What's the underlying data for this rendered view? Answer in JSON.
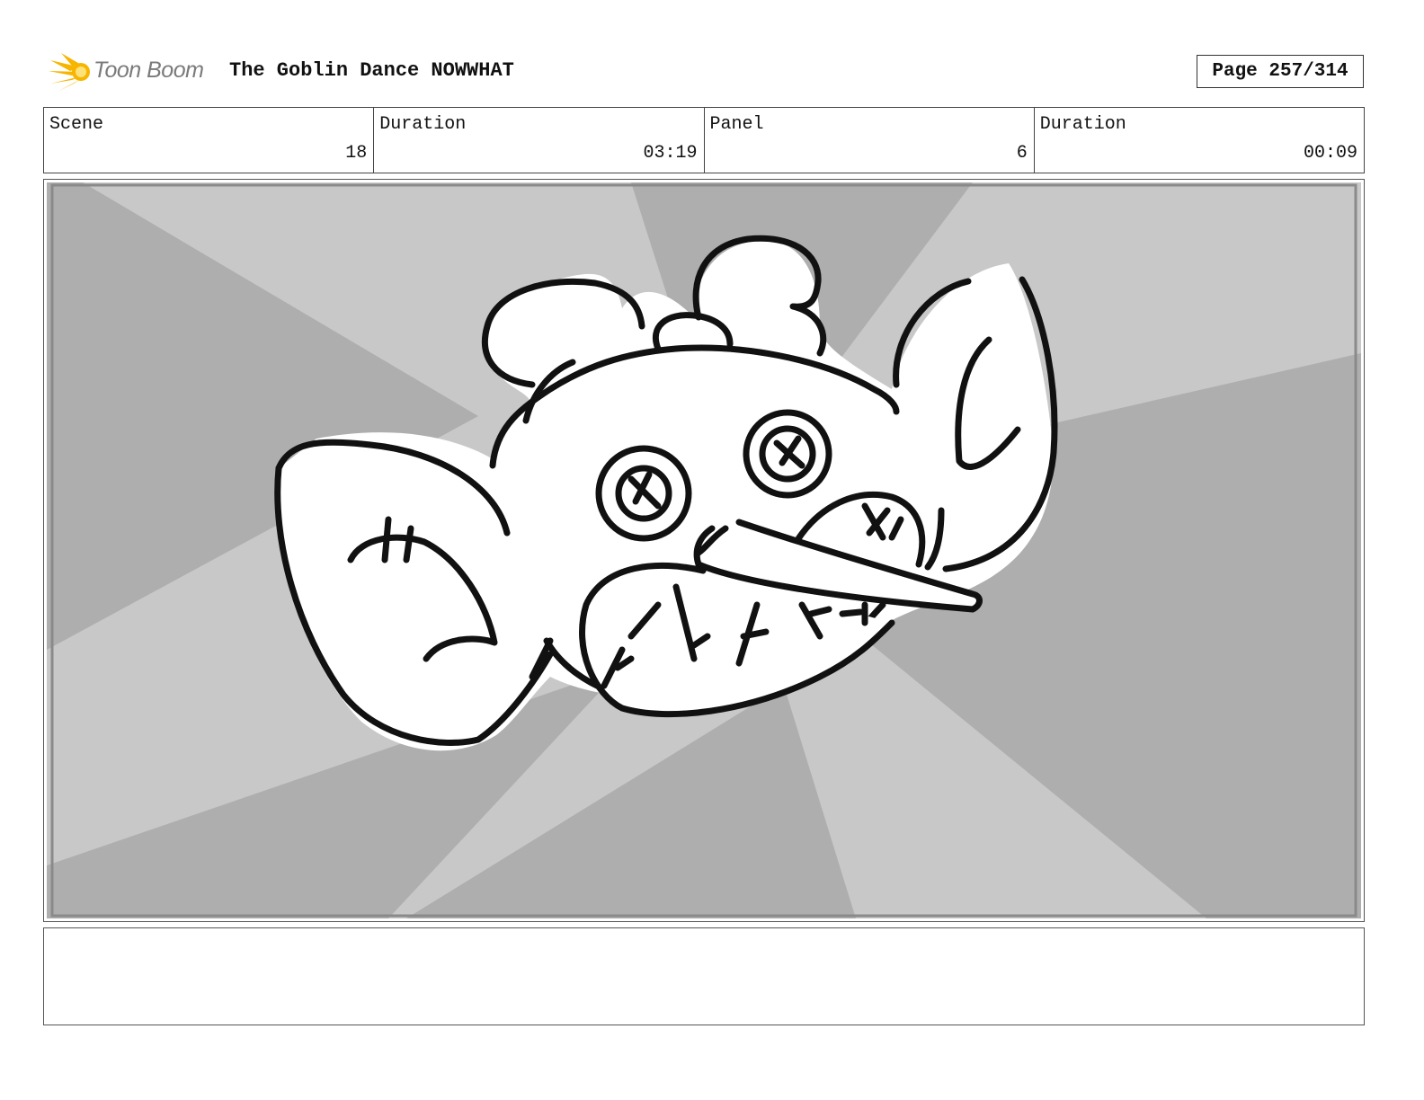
{
  "header": {
    "logo_text": "Toon Boom",
    "project_title": "The Goblin Dance NOWWHAT",
    "page_label": "Page 257/314"
  },
  "info": {
    "scene_label": "Scene",
    "scene_value": "18",
    "scene_duration_label": "Duration",
    "scene_duration_value": "03:19",
    "panel_label": "Panel",
    "panel_value": "6",
    "panel_duration_label": "Duration",
    "panel_duration_value": "00:09"
  },
  "panel": {
    "icon": "goblin-head-sketch",
    "background": "radial-speed-burst",
    "colors": {
      "light": "#c8c8c8",
      "dark": "#aeaeae",
      "ink": "#111111"
    }
  },
  "notes": {
    "text": ""
  }
}
